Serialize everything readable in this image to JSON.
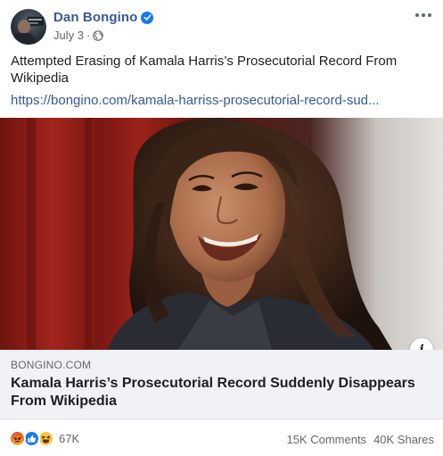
{
  "header": {
    "page_name": "Dan Bongino",
    "date": "July 3",
    "separator": "·",
    "verified_icon": "verified-badge-icon",
    "privacy_icon": "globe-icon",
    "more_icon": "more-options-icon"
  },
  "post": {
    "text": "Attempted Erasing of Kamala Harris’s Prosecutorial Record From Wikipedia",
    "link": "https://bongino.com/kamala-harriss-prosecutorial-record-sud..."
  },
  "link_preview": {
    "domain": "BONGINO.COM",
    "title": "Kamala Harris’s Prosecutorial Record Suddenly Disappears From Wikipedia",
    "info_icon": "info-icon",
    "info_label": "i"
  },
  "footer": {
    "reactions": [
      "angry-react-icon",
      "like-react-icon",
      "haha-react-icon"
    ],
    "reaction_count": "67K",
    "comments": "15K Comments",
    "shares": "40K Shares"
  },
  "colors": {
    "brand_blue": "#385898",
    "verified_blue": "#1877f2",
    "meta_grey": "#65676b",
    "card_bg": "#f0f2f5"
  }
}
